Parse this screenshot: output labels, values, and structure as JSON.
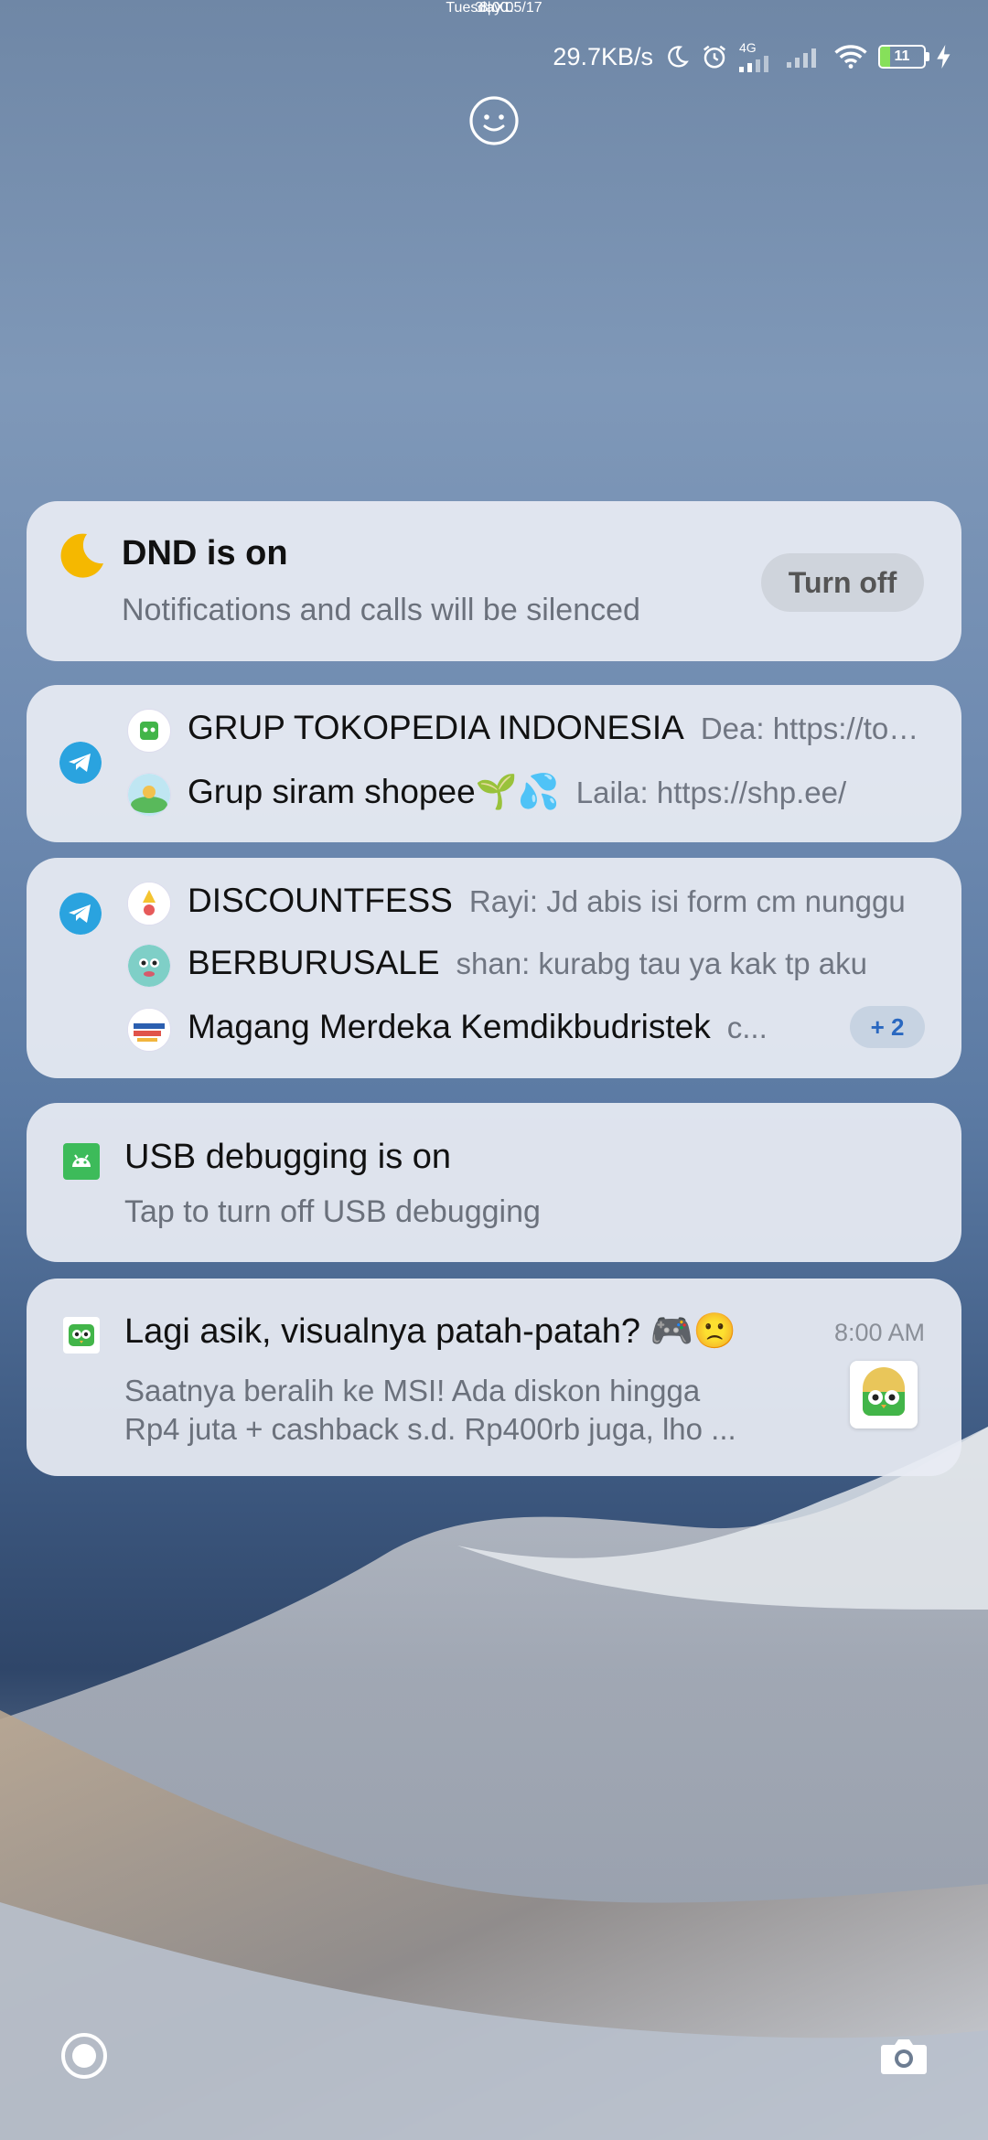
{
  "status_bar": {
    "speed": "29.7KB/s",
    "network": "4G",
    "battery": "11",
    "icons": [
      "moon-icon",
      "alarm-icon",
      "signal-icon",
      "signal-icon",
      "wifi-icon",
      "battery-icon",
      "charging-icon"
    ]
  },
  "lock": {
    "time": "8:00",
    "date": "Tuesday 05/17",
    "carrier": "3 | XL"
  },
  "dnd": {
    "title": "DND is on",
    "subtitle": "Notifications and calls will be silenced",
    "button": "Turn off"
  },
  "telegram_group_1": {
    "rows": [
      {
        "name": "GRUP TOKOPEDIA INDONESIA",
        "message": "Dea: https://tokopedia.link/"
      },
      {
        "name": "Grup siram shopee🌱💦",
        "message": "Laila: https://shp.ee/"
      }
    ]
  },
  "telegram_group_2": {
    "rows": [
      {
        "name": "DISCOUNTFESS",
        "message": "Rayi: Jd abis isi form cm nunggu"
      },
      {
        "name": "BERBURUSALE",
        "message": "shan: kurabg tau ya kak tp aku"
      },
      {
        "name": "Magang Merdeka Kemdikbudristek",
        "message": "c..."
      }
    ],
    "more_badge": "+ 2"
  },
  "usb": {
    "title": "USB debugging is on",
    "subtitle": "Tap to turn off USB debugging"
  },
  "promo": {
    "title": "Lagi asik, visualnya patah-patah? 🎮🙁",
    "time": "8:00 AM",
    "body_line1": "Saatnya beralih ke MSI! Ada diskon hingga",
    "body_line2": "Rp4 juta + cashback s.d. Rp400rb juga, lho ..."
  },
  "colors": {
    "telegram": "#2AA3DF",
    "moon": "#F5B800",
    "android_green": "#3DBB5A",
    "tokopedia_green": "#42B549"
  }
}
